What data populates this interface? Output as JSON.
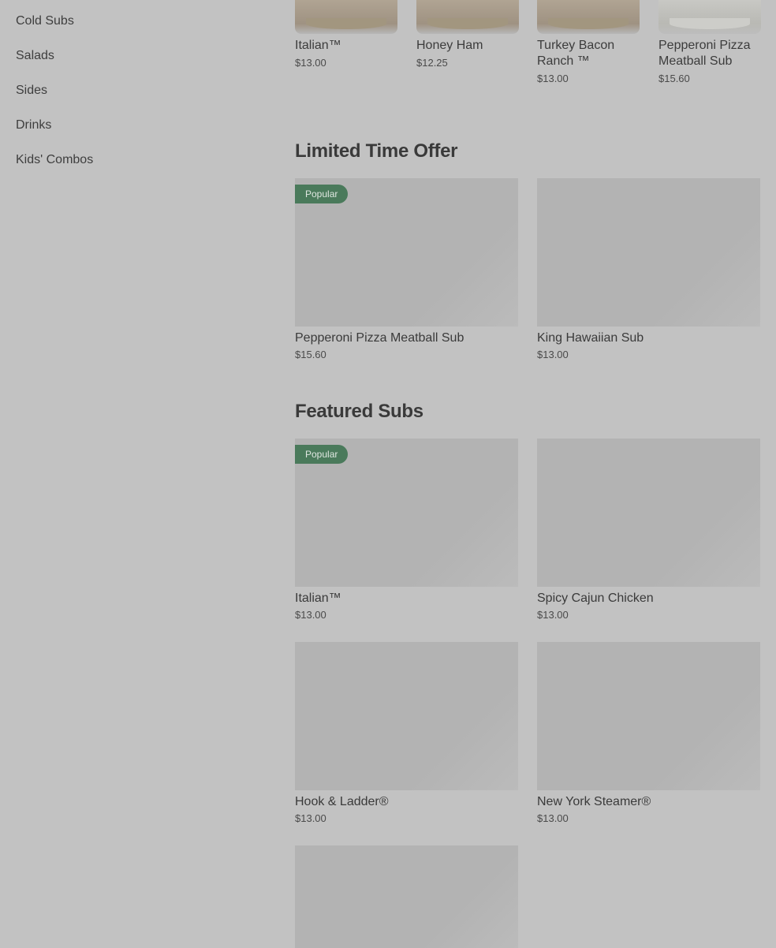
{
  "sidebar": {
    "items": [
      {
        "label": "Cold Subs"
      },
      {
        "label": "Salads"
      },
      {
        "label": "Sides"
      },
      {
        "label": "Drinks"
      },
      {
        "label": "Kids' Combos"
      }
    ]
  },
  "top_strip": [
    {
      "title": "Italian™",
      "price": "$13.00"
    },
    {
      "title": "Honey Ham",
      "price": "$12.25"
    },
    {
      "title": "Turkey Bacon Ranch ™",
      "price": "$13.00"
    },
    {
      "title": "Pepperoni Pizza Meatball Sub",
      "price": "$15.60"
    }
  ],
  "limited_time": {
    "title": "Limited Time Offer",
    "cards": [
      {
        "title": "Pepperoni Pizza Meatball Sub",
        "price": "$15.60",
        "badge": "Popular"
      },
      {
        "title": "King Hawaiian Sub",
        "price": "$13.00"
      }
    ]
  },
  "featured": {
    "title": "Featured Subs",
    "cards": [
      {
        "title": "Italian™",
        "price": "$13.00",
        "badge": "Popular"
      },
      {
        "title": "Spicy Cajun Chicken",
        "price": "$13.00"
      },
      {
        "title": "Hook & Ladder®",
        "price": "$13.00"
      },
      {
        "title": "New York Steamer®",
        "price": "$13.00"
      }
    ]
  },
  "colors": {
    "overlay_background": "#c2c2c2",
    "badge": "#4a7a5b",
    "placeholder": "#b3b3b3"
  }
}
